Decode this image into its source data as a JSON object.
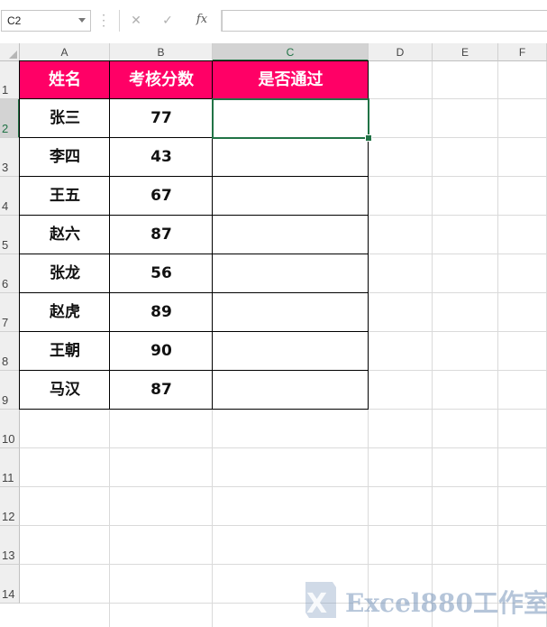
{
  "formula_bar": {
    "name_box": "C2",
    "formula": "",
    "cancel_icon": "✕",
    "enter_icon": "✓",
    "fx_label": "fx"
  },
  "columns": [
    "A",
    "B",
    "C",
    "D",
    "E",
    "F"
  ],
  "rows": [
    "1",
    "2",
    "3",
    "4",
    "5",
    "6",
    "7",
    "8",
    "9",
    "10",
    "11",
    "12",
    "13",
    "14"
  ],
  "table": {
    "headers": [
      "姓名",
      "考核分数",
      "是否通过"
    ],
    "records": [
      {
        "name": "张三",
        "score": "77",
        "pass": ""
      },
      {
        "name": "李四",
        "score": "43",
        "pass": ""
      },
      {
        "name": "王五",
        "score": "67",
        "pass": ""
      },
      {
        "name": "赵六",
        "score": "87",
        "pass": ""
      },
      {
        "name": "张龙",
        "score": "56",
        "pass": ""
      },
      {
        "name": "赵虎",
        "score": "89",
        "pass": ""
      },
      {
        "name": "王朝",
        "score": "90",
        "pass": ""
      },
      {
        "name": "马汉",
        "score": "87",
        "pass": ""
      }
    ]
  },
  "selected_cell": "C2",
  "colors": {
    "header_fill": "#ff0066",
    "header_text": "#ffffff",
    "selection": "#217346"
  },
  "watermark": {
    "logo_text": "X",
    "text": "Excel880工作室"
  }
}
